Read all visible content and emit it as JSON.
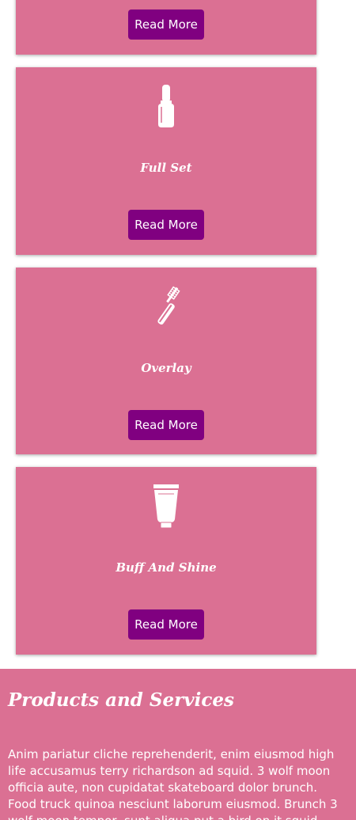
{
  "colors": {
    "card_background": "#db7093",
    "button_background": "#800080",
    "text": "#ffffff"
  },
  "services": [
    {
      "icon": "partial-card",
      "title": "",
      "button_label": "Read More"
    },
    {
      "icon": "nail-polish-icon",
      "title": "Full Set",
      "button_label": "Read More"
    },
    {
      "icon": "mascara-icon",
      "title": "Overlay",
      "button_label": "Read More"
    },
    {
      "icon": "lotion-tube-icon",
      "title": "Buff And Shine",
      "button_label": "Read More"
    }
  ],
  "products_section": {
    "heading": "Products and Services",
    "body": "Anim pariatur cliche reprehenderit, enim eiusmod high life accusamus terry richardson ad squid. 3 wolf moon officia aute, non cupidatat skateboard dolor brunch. Food truck quinoa nesciunt laborum eiusmod. Brunch 3 wolf moon tempor, sunt aliqua put a bird on it squid single-origin coffee nulla assumenda shoreditch et."
  }
}
